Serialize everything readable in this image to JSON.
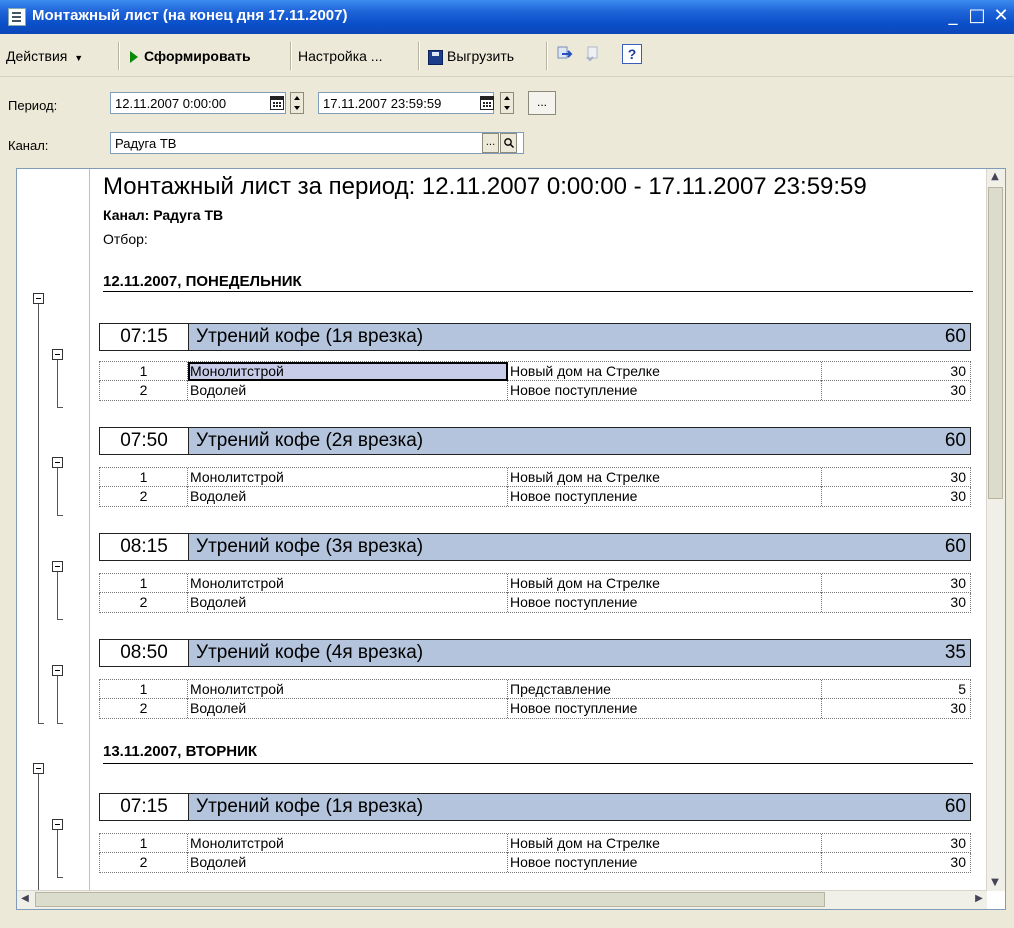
{
  "window": {
    "title": "Монтажный лист (на конец дня 17.11.2007)",
    "controls": {
      "minimize": "_",
      "maximize": "□",
      "close": "✕"
    }
  },
  "toolbar": {
    "actions_label": "Действия",
    "generate_label": "Сформировать",
    "settings_label": "Настройка ...",
    "export_label": "Выгрузить",
    "help_label": "?"
  },
  "form": {
    "period_label": "Период:",
    "period_from": "12.11.2007  0:00:00",
    "period_to": "17.11.2007 23:59:59",
    "channel_label": "Канал:",
    "channel_value": "Радуга ТВ",
    "select_label": "...",
    "dots_label": "..."
  },
  "report": {
    "title": "Монтажный лист за период: 12.11.2007 0:00:00 - 17.11.2007 23:59:59",
    "channel_line": "Канал: Радуга ТВ",
    "filter_line": "Отбор:",
    "days": [
      {
        "header": "12.11.2007, ПОНЕДЕЛЬНИК",
        "blocks": [
          {
            "time": "07:15",
            "name": "Утрений кофе (1я врезка)",
            "duration": "60",
            "rows": [
              {
                "num": "1",
                "client": "Монолитстрой",
                "spot": "Новый дом на Стрелке",
                "duration": "30"
              },
              {
                "num": "2",
                "client": "Водолей",
                "spot": "Новое поступление",
                "duration": "30"
              }
            ]
          },
          {
            "time": "07:50",
            "name": "Утрений кофе (2я врезка)",
            "duration": "60",
            "rows": [
              {
                "num": "1",
                "client": "Монолитстрой",
                "spot": "Новый дом на Стрелке",
                "duration": "30"
              },
              {
                "num": "2",
                "client": "Водолей",
                "spot": "Новое поступление",
                "duration": "30"
              }
            ]
          },
          {
            "time": "08:15",
            "name": "Утрений кофе (3я врезка)",
            "duration": "60",
            "rows": [
              {
                "num": "1",
                "client": "Монолитстрой",
                "spot": "Новый дом на Стрелке",
                "duration": "30"
              },
              {
                "num": "2",
                "client": "Водолей",
                "spot": "Новое поступление",
                "duration": "30"
              }
            ]
          },
          {
            "time": "08:50",
            "name": "Утрений кофе (4я врезка)",
            "duration": "35",
            "rows": [
              {
                "num": "1",
                "client": "Монолитстрой",
                "spot": "Представление",
                "duration": "5"
              },
              {
                "num": "2",
                "client": "Водолей",
                "spot": "Новое поступление",
                "duration": "30"
              }
            ]
          }
        ]
      },
      {
        "header": "13.11.2007, ВТОРНИК",
        "blocks": [
          {
            "time": "07:15",
            "name": "Утрений кофе (1я врезка)",
            "duration": "60",
            "rows": [
              {
                "num": "1",
                "client": "Монолитстрой",
                "spot": "Новый дом на Стрелке",
                "duration": "30"
              },
              {
                "num": "2",
                "client": "Водолей",
                "spot": "Новое поступление",
                "duration": "30"
              }
            ]
          }
        ]
      }
    ]
  },
  "colors": {
    "block_header_bg": "#b4c4dc",
    "titlebar": "#0a4fc8",
    "selected_cell": "#c8cce8"
  }
}
